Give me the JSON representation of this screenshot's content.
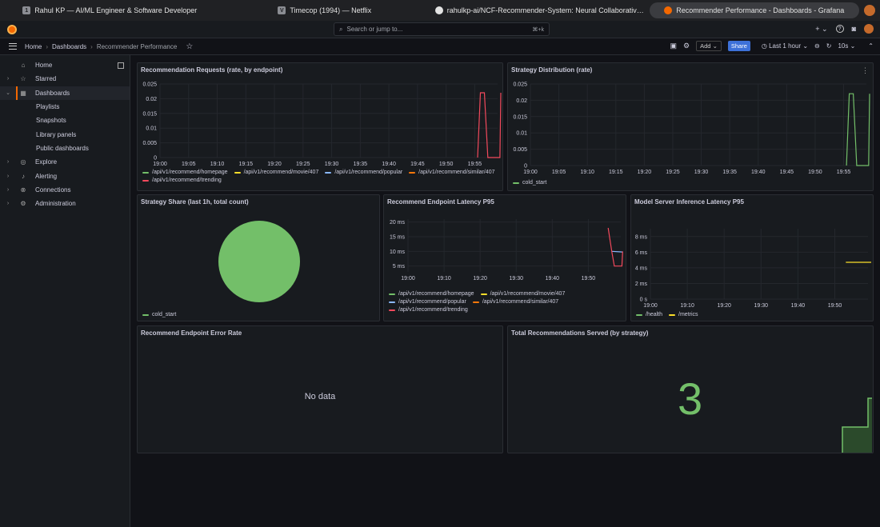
{
  "tabs": [
    {
      "label": "Rahul KP — AI/ML Engineer & Software Developer",
      "icon": "1",
      "active": false
    },
    {
      "label": "Timecop (1994) — Netflix",
      "icon": "V",
      "active": false
    },
    {
      "label": "rahulkp-ai/NCF-Recommender-System: Neural Collaborativ…",
      "icon": "github-icon",
      "active": false
    },
    {
      "label": "Recommender Performance - Dashboards - Grafana",
      "icon": "grafana-icon",
      "active": true
    }
  ],
  "search": {
    "placeholder": "Search or jump to...",
    "shortcut": "⌘+k"
  },
  "topbar": {
    "plus": "+ ⌄",
    "help": "?",
    "news": "◙"
  },
  "breadcrumb": {
    "home": "Home",
    "dashboards": "Dashboards",
    "current": "Recommender Performance"
  },
  "toolbar": {
    "add": "Add",
    "share": "Share",
    "time_range": "Last 1 hour",
    "refresh": "10s"
  },
  "sidebar": {
    "items": [
      {
        "label": "Home",
        "icon": "home-icon",
        "chev": ""
      },
      {
        "label": "Starred",
        "icon": "star-icon",
        "chev": "›"
      },
      {
        "label": "Dashboards",
        "icon": "grid-icon",
        "chev": "⌄",
        "active": true
      },
      {
        "label": "Playlists",
        "sub": true
      },
      {
        "label": "Snapshots",
        "sub": true
      },
      {
        "label": "Library panels",
        "sub": true
      },
      {
        "label": "Public dashboards",
        "sub": true
      },
      {
        "label": "Explore",
        "icon": "compass-icon",
        "chev": "›"
      },
      {
        "label": "Alerting",
        "icon": "bell-icon",
        "chev": "›"
      },
      {
        "label": "Connections",
        "icon": "plug-icon",
        "chev": "›"
      },
      {
        "label": "Administration",
        "icon": "cog-icon",
        "chev": "›"
      }
    ]
  },
  "colors": {
    "green": "#73bf69",
    "yellow": "#fade2a",
    "blue": "#8ab8ff",
    "orange": "#ff780a",
    "red": "#f2495c"
  },
  "panels": {
    "requests": {
      "title": "Recommendation Requests (rate, by endpoint)"
    },
    "strategy_dist": {
      "title": "Strategy Distribution (rate)"
    },
    "strategy_share": {
      "title": "Strategy Share (last 1h, total count)"
    },
    "latency": {
      "title": "Recommend Endpoint Latency P95"
    },
    "model_latency": {
      "title": "Model Server Inference Latency P95"
    },
    "error_rate": {
      "title": "Recommend Endpoint Error Rate",
      "no_data": "No data"
    },
    "total": {
      "title": "Total Recommendations Served (by strategy)",
      "value": "3"
    }
  },
  "chart_data": [
    {
      "id": "requests",
      "type": "line",
      "x": [
        "19:00",
        "19:05",
        "19:10",
        "19:15",
        "19:20",
        "19:25",
        "19:30",
        "19:35",
        "19:40",
        "19:45",
        "19:50",
        "19:55"
      ],
      "yticks": [
        "0",
        "0.005",
        "0.01",
        "0.015",
        "0.02",
        "0.025"
      ],
      "ylim": [
        0,
        0.025
      ],
      "xlim": [
        0,
        59
      ],
      "series": [
        {
          "name": "/api/v1/recommend/homepage",
          "color": "#73bf69",
          "points": []
        },
        {
          "name": "/api/v1/recommend/movie/407",
          "color": "#fade2a",
          "points": []
        },
        {
          "name": "/api/v1/recommend/popular",
          "color": "#8ab8ff",
          "points": []
        },
        {
          "name": "/api/v1/recommend/similar/407",
          "color": "#ff780a",
          "points": []
        },
        {
          "name": "/api/v1/recommend/trending",
          "color": "#f2495c",
          "points": [
            [
              55.5,
              0
            ],
            [
              56,
              0.022
            ],
            [
              56.7,
              0.022
            ],
            [
              57.3,
              0
            ],
            [
              59.4,
              0
            ],
            [
              59.9,
              0.022
            ],
            [
              60.3,
              0.022
            ]
          ]
        }
      ]
    },
    {
      "id": "strategy_dist",
      "type": "line",
      "x": [
        "19:00",
        "19:05",
        "19:10",
        "19:15",
        "19:20",
        "19:25",
        "19:30",
        "19:35",
        "19:40",
        "19:45",
        "19:50",
        "19:55"
      ],
      "yticks": [
        "0",
        "0.005",
        "0.01",
        "0.015",
        "0.02",
        "0.025"
      ],
      "ylim": [
        0,
        0.025
      ],
      "xlim": [
        0,
        59
      ],
      "series": [
        {
          "name": "cold_start",
          "color": "#73bf69",
          "points": [
            [
              55.5,
              0
            ],
            [
              56,
              0.022
            ],
            [
              56.7,
              0.022
            ],
            [
              57.3,
              0
            ],
            [
              59.4,
              0
            ],
            [
              59.9,
              0.022
            ],
            [
              60.3,
              0.022
            ]
          ]
        }
      ]
    },
    {
      "id": "strategy_share",
      "type": "pie",
      "series": [
        {
          "name": "cold_start",
          "color": "#73bf69",
          "value": 1
        }
      ]
    },
    {
      "id": "latency",
      "type": "line",
      "x": [
        "19:00",
        "19:10",
        "19:20",
        "19:30",
        "19:40",
        "19:50"
      ],
      "yticks": [
        "5 ms",
        "10 ms",
        "15 ms",
        "20 ms"
      ],
      "ylim": [
        3,
        21
      ],
      "xlim": [
        0,
        59
      ],
      "series": [
        {
          "name": "/api/v1/recommend/homepage",
          "color": "#73bf69",
          "points": []
        },
        {
          "name": "/api/v1/recommend/movie/407",
          "color": "#fade2a",
          "points": []
        },
        {
          "name": "/api/v1/recommend/popular",
          "color": "#8ab8ff",
          "points": [
            [
              56.5,
              10
            ],
            [
              59.5,
              9.8
            ]
          ]
        },
        {
          "name": "/api/v1/recommend/similar/407",
          "color": "#ff780a",
          "points": []
        },
        {
          "name": "/api/v1/recommend/trending",
          "color": "#f2495c",
          "points": [
            [
              55.5,
              18
            ],
            [
              56.5,
              10
            ],
            [
              57.2,
              5
            ],
            [
              59.3,
              5
            ],
            [
              59.5,
              10
            ]
          ]
        }
      ]
    },
    {
      "id": "model_latency",
      "type": "line",
      "x": [
        "19:00",
        "19:10",
        "19:20",
        "19:30",
        "19:40",
        "19:50"
      ],
      "yticks": [
        "0 s",
        "2 ms",
        "4 ms",
        "6 ms",
        "8 ms"
      ],
      "ylim": [
        0,
        9
      ],
      "xlim": [
        0,
        59
      ],
      "series": [
        {
          "name": "/health",
          "color": "#73bf69",
          "points": []
        },
        {
          "name": "/metrics",
          "color": "#fade2a",
          "points": [
            [
              53,
              4.7
            ],
            [
              60,
              4.7
            ]
          ]
        }
      ]
    }
  ]
}
